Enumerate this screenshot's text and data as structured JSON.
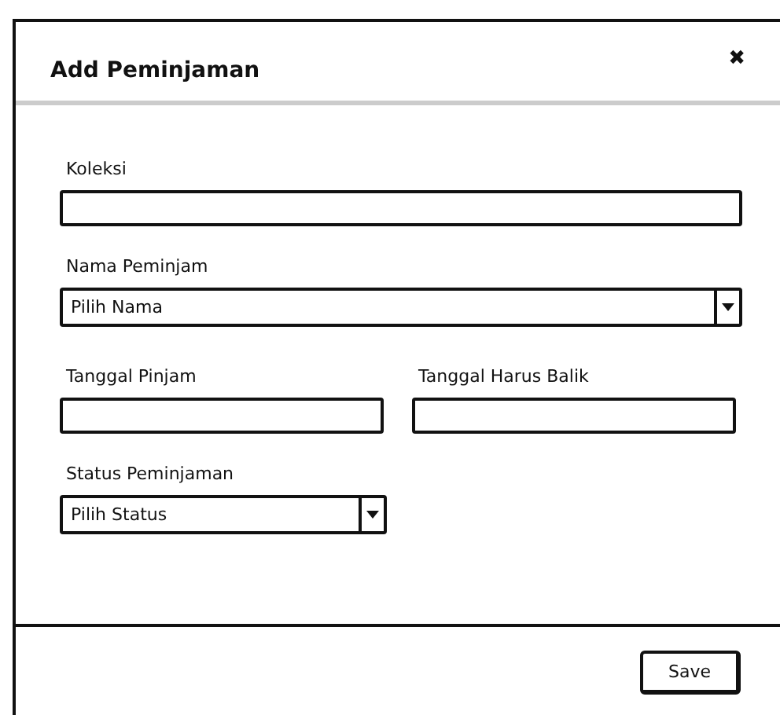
{
  "dialog": {
    "title": "Add Peminjaman",
    "close": "✖"
  },
  "rows": [
    [
      {
        "label": "Koleksi",
        "kind": "text"
      }
    ],
    [
      {
        "label": "Nama Peminjam",
        "kind": "select",
        "value": "Pilih Nama"
      }
    ],
    [
      {
        "label": "Tanggal Pinjam",
        "kind": "text"
      },
      {
        "label": "Tanggal Harus Balik",
        "kind": "text"
      }
    ],
    [
      {
        "label": "Status Peminjaman",
        "kind": "select",
        "value": "Pilih Status"
      }
    ]
  ],
  "buttons": [
    "Save"
  ]
}
